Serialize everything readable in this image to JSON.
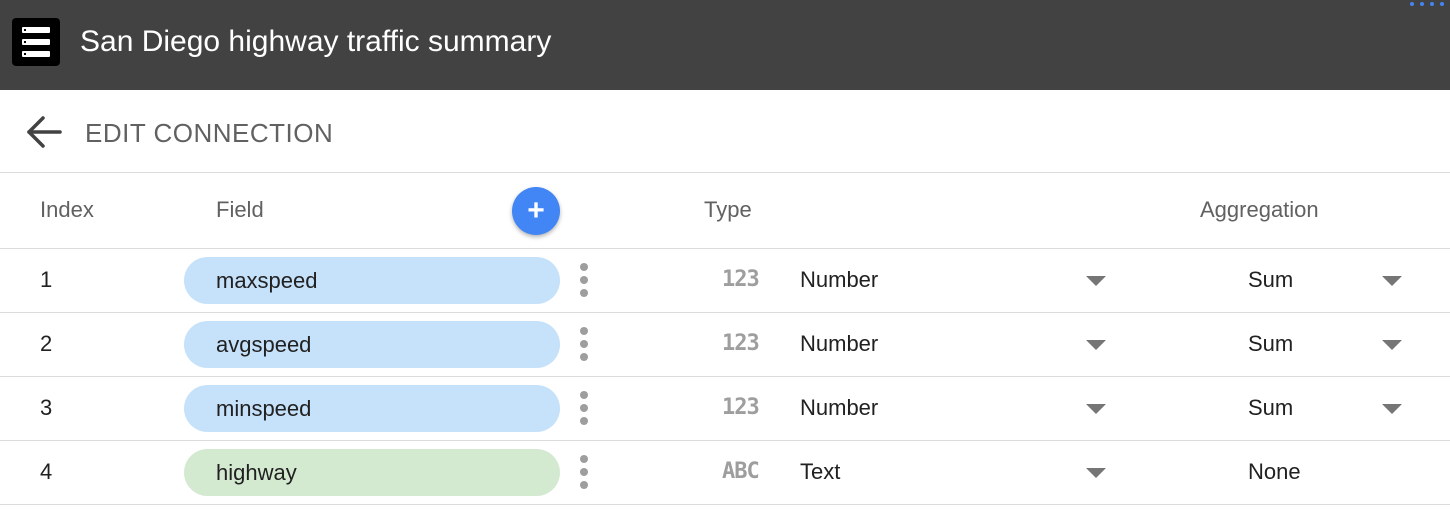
{
  "header": {
    "title": "San Diego highway traffic summary",
    "icon": "database-list-icon",
    "more_icon": "more-dots-icon",
    "background": "#424242"
  },
  "subbar": {
    "back_icon": "arrow-back-icon",
    "title": "EDIT CONNECTION"
  },
  "table": {
    "headers": {
      "index": "Index",
      "field": "Field",
      "type": "Type",
      "aggregation": "Aggregation"
    },
    "add_button_label": "+",
    "rows": [
      {
        "index": "1",
        "field": "maxspeed",
        "type_icon": "123",
        "type": "Number",
        "aggregation": "Sum",
        "field_color": "#c6e1fa",
        "has_agg_dropdown": true
      },
      {
        "index": "2",
        "field": "avgspeed",
        "type_icon": "123",
        "type": "Number",
        "aggregation": "Sum",
        "field_color": "#c6e1fa",
        "has_agg_dropdown": true
      },
      {
        "index": "3",
        "field": "minspeed",
        "type_icon": "123",
        "type": "Number",
        "aggregation": "Sum",
        "field_color": "#c6e1fa",
        "has_agg_dropdown": true
      },
      {
        "index": "4",
        "field": "highway",
        "type_icon": "ABC",
        "type": "Text",
        "aggregation": "None",
        "field_color": "#d3ead1",
        "has_agg_dropdown": false
      }
    ]
  },
  "colors": {
    "accent": "#4285f4",
    "dimension_pill": "#d3ead1",
    "metric_pill": "#c6e1fa"
  }
}
